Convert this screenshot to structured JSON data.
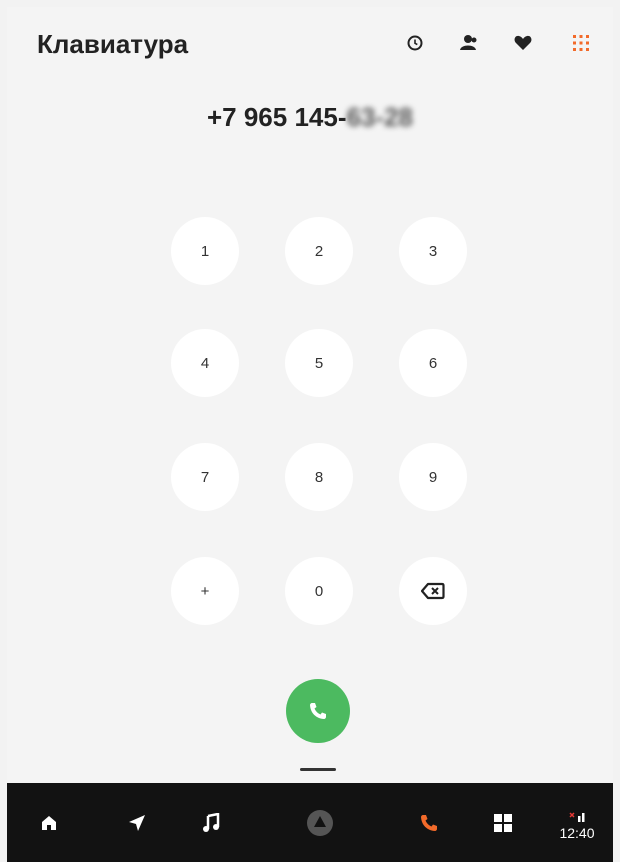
{
  "header": {
    "title": "Клавиатура",
    "icons": [
      "history-icon",
      "contacts-icon",
      "favorites-icon",
      "keypad-icon"
    ],
    "accent_color": "#f26a2a"
  },
  "dialed_number": {
    "visible": "+7 965 145-",
    "obscured": "63-28"
  },
  "keypad": {
    "keys": [
      "1",
      "2",
      "3",
      "4",
      "5",
      "6",
      "7",
      "8",
      "9",
      "+",
      "0",
      "backspace"
    ]
  },
  "call_button": {
    "color": "#4cba60",
    "icon": "phone-icon"
  },
  "navbar": {
    "items": [
      "home-icon",
      "navigation-icon",
      "music-icon",
      "assistant-icon",
      "phone-icon",
      "apps-icon"
    ],
    "active": "phone-icon",
    "time": "12:40"
  }
}
